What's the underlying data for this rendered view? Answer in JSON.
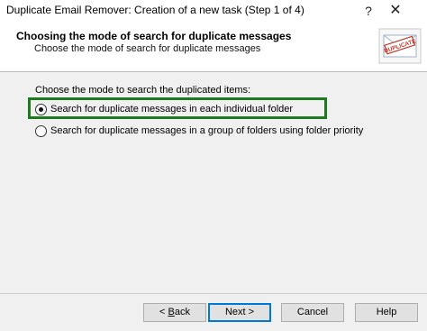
{
  "window": {
    "title": "Duplicate Email Remover: Creation of a new task (Step 1 of 4)",
    "help_glyph": "?",
    "close_glyph": "✕"
  },
  "header": {
    "title": "Choosing the mode of search for duplicate messages",
    "subtitle": "Choose the mode of search for duplicate messages",
    "image_text": "DUPLICATE",
    "image_icon": "duplicate-envelope-icon"
  },
  "content": {
    "prompt": "Choose the mode to search the duplicated items:",
    "options": [
      {
        "label": "Search for duplicate messages in each individual folder",
        "checked": true
      },
      {
        "label": "Search for duplicate messages in a group of folders using folder priority",
        "checked": false
      }
    ]
  },
  "buttons": {
    "back_prefix": "< ",
    "back_accel": "B",
    "back_rest": "ack",
    "next": "Next >",
    "cancel": "Cancel",
    "help": "Help"
  },
  "colors": {
    "highlight": "#1f7a1f",
    "default_button_border": "#0078d7"
  }
}
